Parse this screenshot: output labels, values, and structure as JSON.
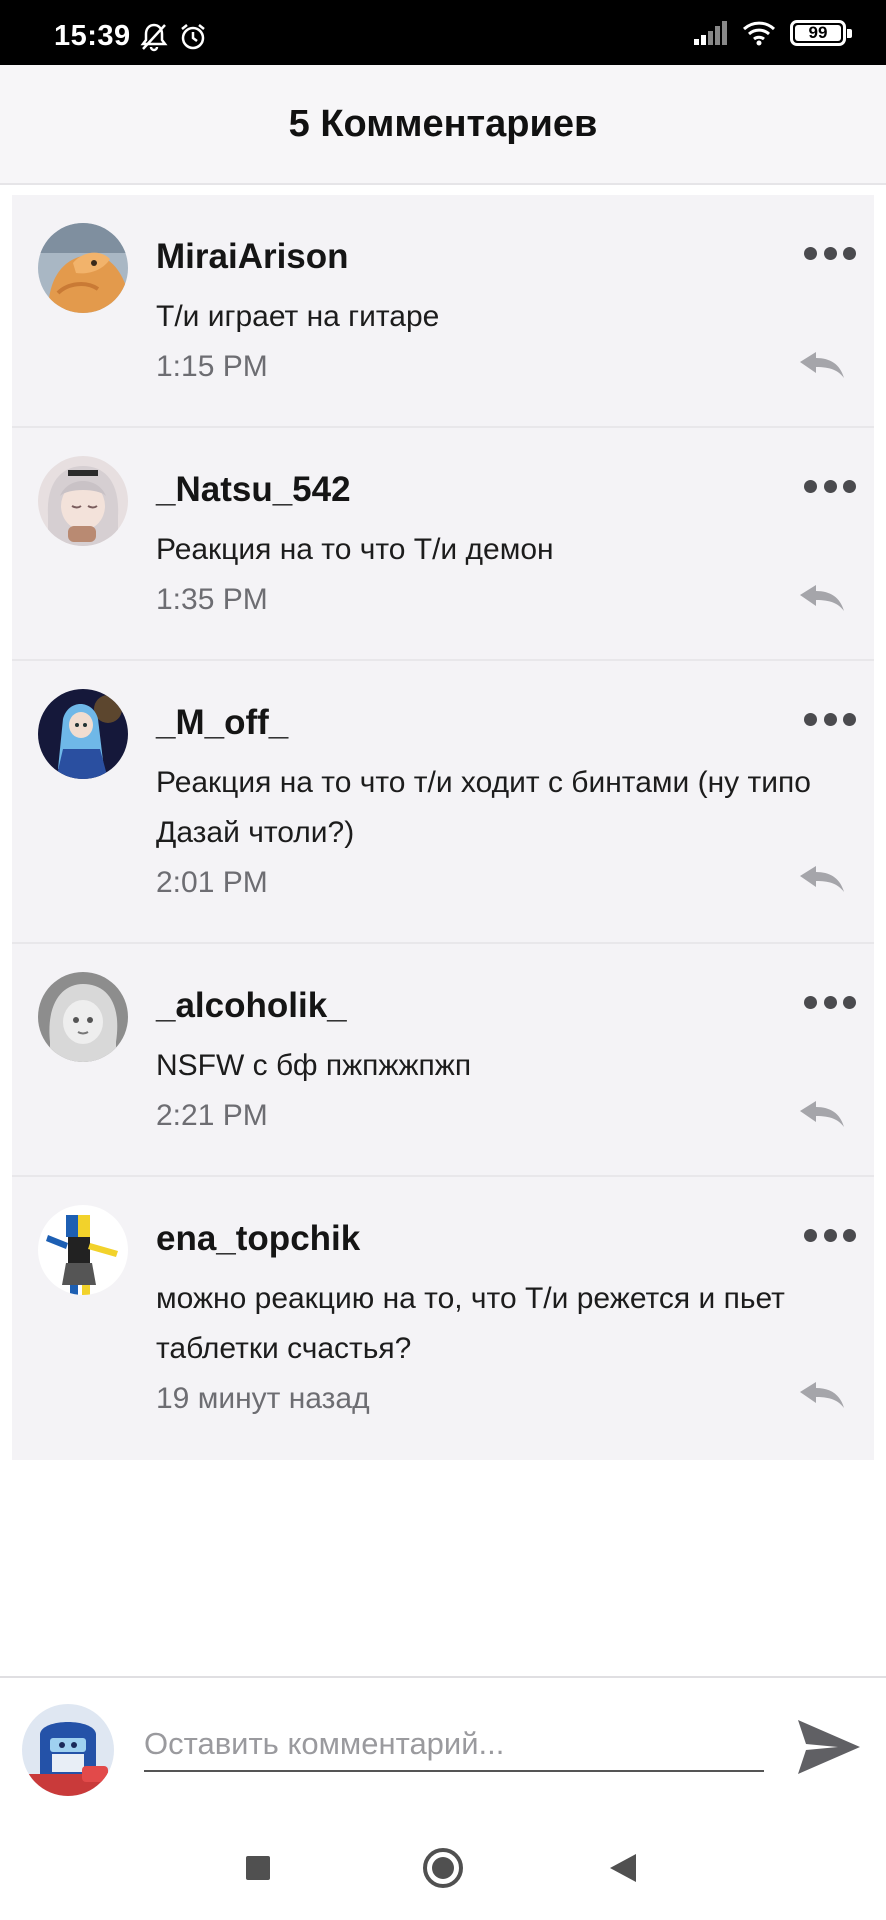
{
  "status_bar": {
    "time": "15:39",
    "battery": "99",
    "battery_level": 0.99,
    "icons": [
      "bell-off-icon",
      "alarm-icon",
      "signal-icon",
      "wifi-icon",
      "battery-icon"
    ]
  },
  "header": {
    "title": "5 Комментариев"
  },
  "comments": [
    {
      "author": "MiraiArison",
      "text": "Т/и играет на гитаре",
      "time": "1:15 PM",
      "avatar": "avatar-cat"
    },
    {
      "author": "_Natsu_542",
      "text": "Реакция на то что Т/и демон",
      "time": "1:35 PM",
      "avatar": "avatar-anime-girl"
    },
    {
      "author": "_M_off_",
      "text": "Реакция на то что т/и ходит с бинтами (ну типо Дазай чтоли?)",
      "time": "2:01 PM",
      "avatar": "avatar-blue-hair"
    },
    {
      "author": "_alcoholik_",
      "text": "NSFW с бф пжпжжпжп",
      "time": "2:21 PM",
      "avatar": "avatar-grey"
    },
    {
      "author": "ena_topchik",
      "text": "можно реакцию на то, что Т/и режется и пьет таблетки счастья?",
      "time": "19 минут назад",
      "avatar": "avatar-ena"
    }
  ],
  "composer": {
    "placeholder": "Оставить комментарий...",
    "value": ""
  },
  "nav": {
    "icons": [
      "recents-square-icon",
      "home-circle-icon",
      "back-triangle-icon"
    ]
  },
  "colors": {
    "status_bar_bg": "#000000",
    "header_bg": "#f7f6f8",
    "card_bg": "#f4f3f6",
    "text_primary": "#151515",
    "text_secondary": "#6d6d72"
  }
}
